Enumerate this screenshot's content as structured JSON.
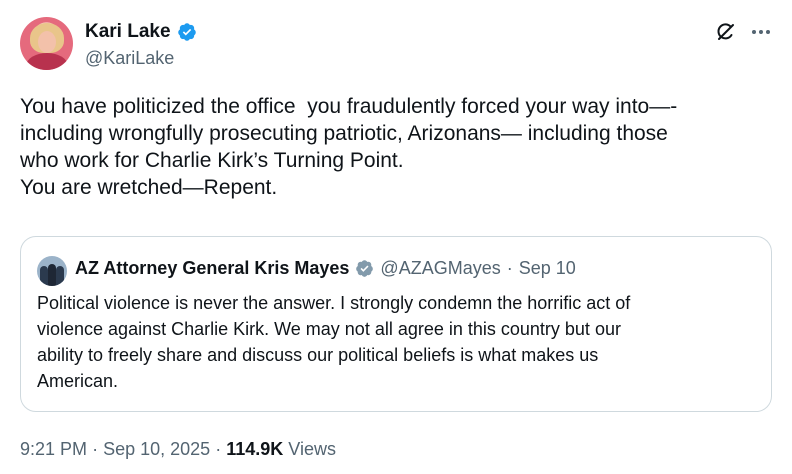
{
  "author": {
    "display_name": "Kari Lake",
    "handle": "@KariLake",
    "verified": true,
    "verified_color": "#1d9bf0"
  },
  "header_icons": [
    "grok-icon",
    "more-icon"
  ],
  "tweet": {
    "lines": [
      "You have politicized the office  you fraudulently forced your way into—-",
      "including wrongfully prosecuting patriotic, Arizonans— including those",
      "who work for Charlie Kirk’s Turning Point.",
      "You are wretched—Repent."
    ]
  },
  "quote": {
    "display_name": "AZ Attorney General Kris Mayes",
    "verified": true,
    "verified_color": "#829aab",
    "handle": "@AZAGMayes",
    "separator": "·",
    "date": "Sep 10",
    "lines": [
      "Political violence is never the answer. I strongly condemn the horrific act of",
      "violence against Charlie Kirk. We may not all agree in this country but our",
      "ability to freely share and discuss our political beliefs is what makes us",
      "American."
    ]
  },
  "meta": {
    "time": "9:21 PM",
    "separator": "·",
    "date": "Sep 10, 2025",
    "views_count": "114.9K",
    "views_label": "Views"
  },
  "colors": {
    "text": "#0f1419",
    "secondary": "#536471",
    "border": "#cfd9de"
  }
}
